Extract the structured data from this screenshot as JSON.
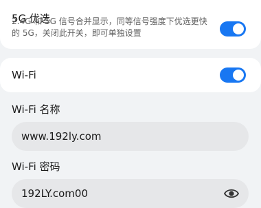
{
  "five_g": {
    "title": "5G 优选",
    "description": "2.4G 和 5G 信号合并显示，同等信号强度下优选更快的 5G，关闭此开关，即可单独设置",
    "enabled": true
  },
  "wifi": {
    "title": "Wi-Fi",
    "enabled": true
  },
  "ssid": {
    "label": "Wi-Fi 名称",
    "value": "www.192ly.com"
  },
  "password": {
    "label": "Wi-Fi 密码",
    "value": "192LY.com00",
    "visibility_icon": "eye-icon"
  },
  "colors": {
    "accent": "#1877f2",
    "background": "#f1f3f5",
    "field": "#e6e7e9"
  }
}
